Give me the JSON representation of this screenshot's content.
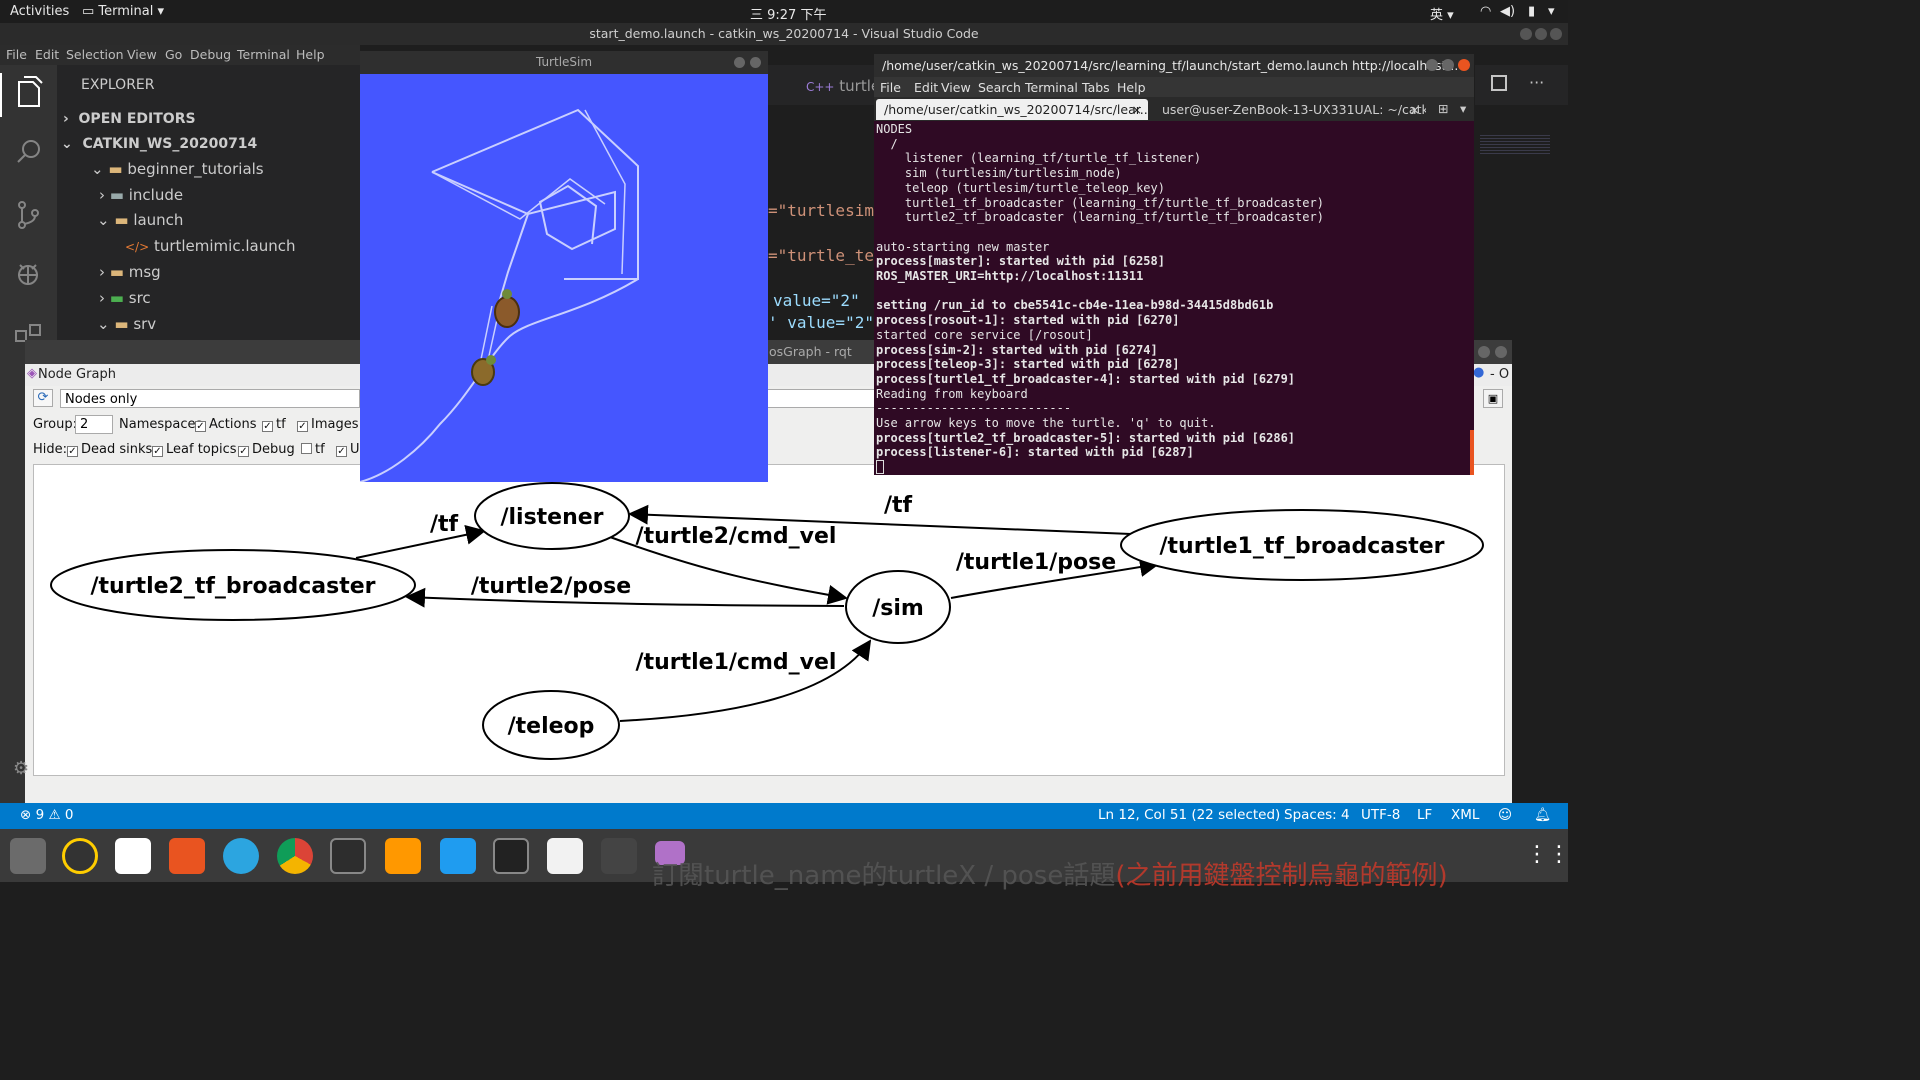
{
  "topbar": {
    "activities": "Activities",
    "app_menu": "Terminal",
    "clock": "三 9:27 下午",
    "input_method": "英"
  },
  "vscode": {
    "window_title": "start_demo.launch - catkin_ws_20200714 - Visual Studio Code",
    "menu": [
      "File",
      "Edit",
      "Selection",
      "View",
      "Go",
      "Debug",
      "Terminal",
      "Help"
    ],
    "explorer_title": "EXPLORER",
    "open_editors": "OPEN EDITORS",
    "workspace": "CATKIN_WS_20200714",
    "tree": [
      {
        "label": "beginner_tutorials"
      },
      {
        "label": "include"
      },
      {
        "label": "launch"
      },
      {
        "label": "turtlemimic.launch"
      },
      {
        "label": "msg"
      },
      {
        "label": "src"
      },
      {
        "label": "srv"
      }
    ],
    "tab_label": "turtle_",
    "code_fragments": [
      "=\"turtlesim",
      "=\"turtle_te",
      "value=\"2\"",
      "' value=\"2\""
    ],
    "status": {
      "errors": "9",
      "warnings": "0",
      "position": "Ln 12, Col 51 (22 selected)",
      "spaces": "Spaces: 4",
      "encoding": "UTF-8",
      "eol": "LF",
      "language": "XML"
    }
  },
  "turtlesim": {
    "title": "TurtleSim",
    "background": "#4556ff"
  },
  "terminal": {
    "title": "/home/user/catkin_ws_20200714/src/learning_tf/launch/start_demo.launch http://localhost...",
    "menu": [
      "File",
      "Edit",
      "View",
      "Search",
      "Terminal",
      "Tabs",
      "Help"
    ],
    "tabs": [
      "/home/user/catkin_ws_20200714/src/lear...",
      "user@user-ZenBook-13-UX331UAL: ~/catki..."
    ],
    "lines": [
      {
        "text": "NODES",
        "bold": false
      },
      {
        "text": "  /",
        "bold": false
      },
      {
        "text": "    listener (learning_tf/turtle_tf_listener)",
        "bold": false
      },
      {
        "text": "    sim (turtlesim/turtlesim_node)",
        "bold": false
      },
      {
        "text": "    teleop (turtlesim/turtle_teleop_key)",
        "bold": false
      },
      {
        "text": "    turtle1_tf_broadcaster (learning_tf/turtle_tf_broadcaster)",
        "bold": false
      },
      {
        "text": "    turtle2_tf_broadcaster (learning_tf/turtle_tf_broadcaster)",
        "bold": false
      },
      {
        "text": "",
        "bold": false
      },
      {
        "text": "auto-starting new master",
        "bold": false
      },
      {
        "text": "process[master]: started with pid [6258]",
        "bold": true
      },
      {
        "text": "ROS_MASTER_URI=http://localhost:11311",
        "bold": true
      },
      {
        "text": "",
        "bold": false
      },
      {
        "text": "setting /run_id to cbe5541c-cb4e-11ea-b98d-34415d8bd61b",
        "bold": true
      },
      {
        "text": "process[rosout-1]: started with pid [6270]",
        "bold": true
      },
      {
        "text": "started core service [/rosout]",
        "bold": false
      },
      {
        "text": "process[sim-2]: started with pid [6274]",
        "bold": true
      },
      {
        "text": "process[teleop-3]: started with pid [6278]",
        "bold": true
      },
      {
        "text": "process[turtle1_tf_broadcaster-4]: started with pid [6279]",
        "bold": true
      },
      {
        "text": "Reading from keyboard",
        "bold": false
      },
      {
        "text": "---------------------------",
        "bold": false
      },
      {
        "text": "Use arrow keys to move the turtle. 'q' to quit.",
        "bold": false
      },
      {
        "text": "process[turtle2_tf_broadcaster-5]: started with pid [6286]",
        "bold": true
      },
      {
        "text": "process[listener-6]: started with pid [6287]",
        "bold": true
      }
    ]
  },
  "rqt": {
    "window_title": "osGraph - rqt",
    "plugin_label": "Node Graph",
    "mode": "Nodes only",
    "group_label": "Group:",
    "group_value": "2",
    "options": [
      "Namespaces",
      "Actions",
      "tf",
      "Images"
    ],
    "options_checked": [
      false,
      true,
      true,
      true
    ],
    "hide_label": "Hide:",
    "hide_options": [
      "Dead sinks",
      "Leaf topics",
      "Debug",
      "tf",
      "U"
    ],
    "hide_checked": [
      true,
      true,
      true,
      false,
      true
    ],
    "graph": {
      "nodes": [
        "/listener",
        "/turtle2_tf_broadcaster",
        "/sim",
        "/turtle1_tf_broadcaster",
        "/teleop"
      ],
      "edges": [
        "/tf",
        "/turtle2/cmd_vel",
        "/turtle2/pose",
        "/tf",
        "/turtle1/pose",
        "/turtle1/cmd_vel"
      ]
    }
  },
  "overlay_text": "訂閱turtle_name的turtleX / pose話題",
  "overlay_text_red": "(之前用鍵盤控制烏龜的範例)",
  "colors": {
    "vscode_status": "#007acc",
    "terminal_bg": "#2f0a24",
    "ubuntu_orange": "#e95420"
  }
}
